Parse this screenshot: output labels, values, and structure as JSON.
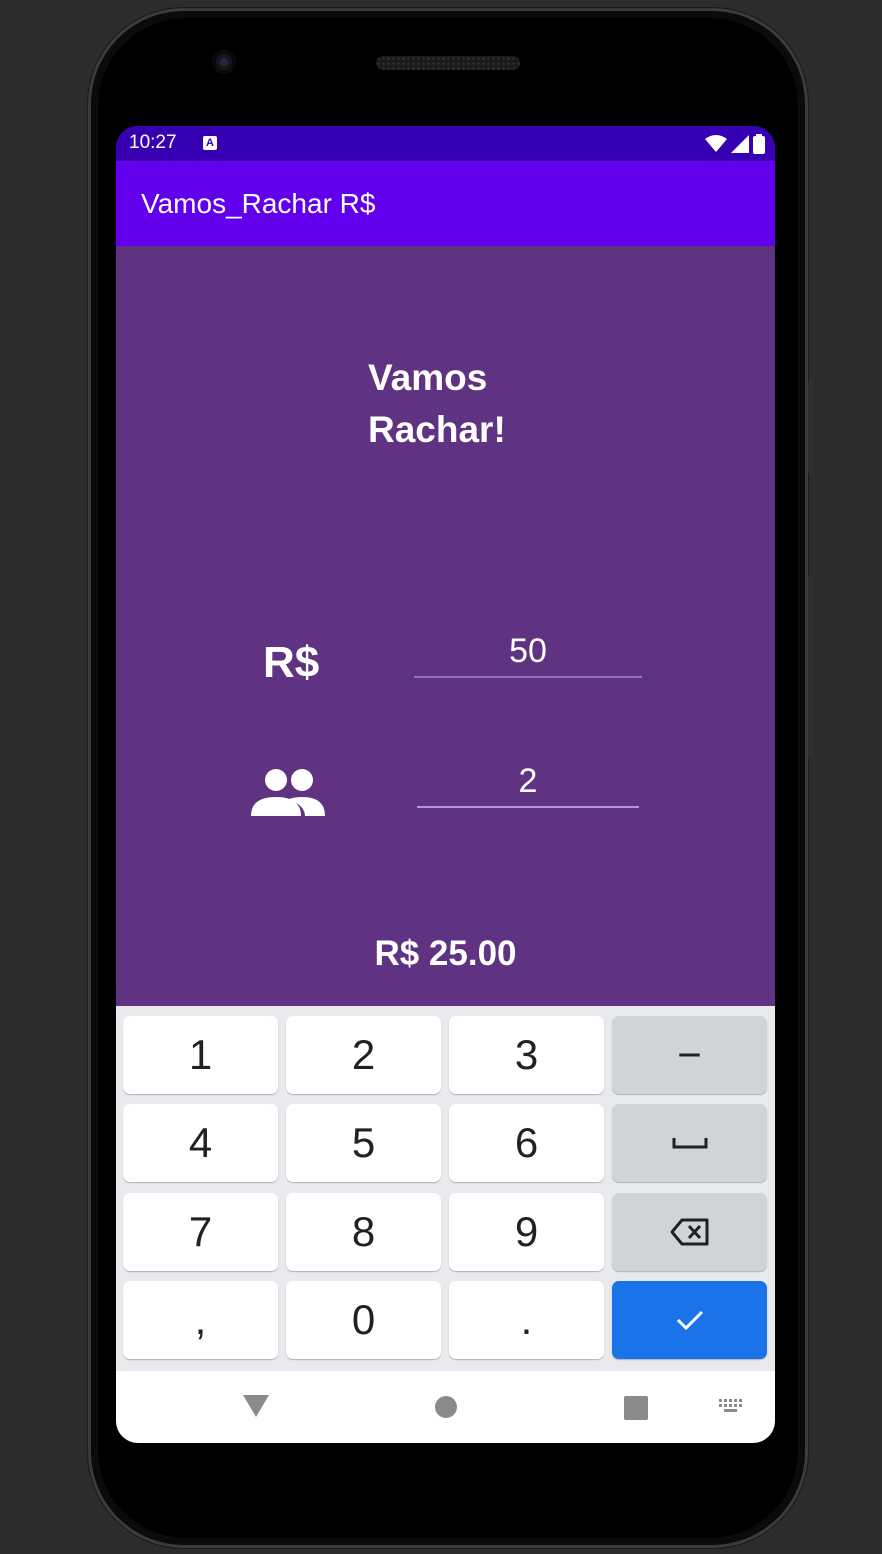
{
  "status_bar": {
    "time": "10:27",
    "notification_badge": "A"
  },
  "app_bar": {
    "title": "Vamos_Rachar R$"
  },
  "main": {
    "headline_line1": "Vamos",
    "headline_line2": "Rachar!",
    "amount_label": "R$",
    "amount_value": "50",
    "people_icon": "group-icon",
    "people_value": "2",
    "result": "R$ 25.00"
  },
  "keyboard": {
    "rows": [
      [
        "1",
        "2",
        "3",
        "−"
      ],
      [
        "4",
        "5",
        "6",
        "␣"
      ],
      [
        "7",
        "8",
        "9",
        "⌫"
      ],
      [
        ",",
        "0",
        ".",
        "✓"
      ]
    ],
    "icons": {
      "space": "space-icon",
      "backspace": "backspace-icon",
      "done": "check-icon"
    }
  },
  "nav_bar": {
    "icons": [
      "back-icon",
      "home-icon",
      "recents-icon",
      "keyboard-switch-icon"
    ]
  },
  "colors": {
    "status_bar": "#3700b3",
    "app_bar": "#6200ee",
    "background": "#5f3381",
    "accent_key": "#1a73e8"
  }
}
